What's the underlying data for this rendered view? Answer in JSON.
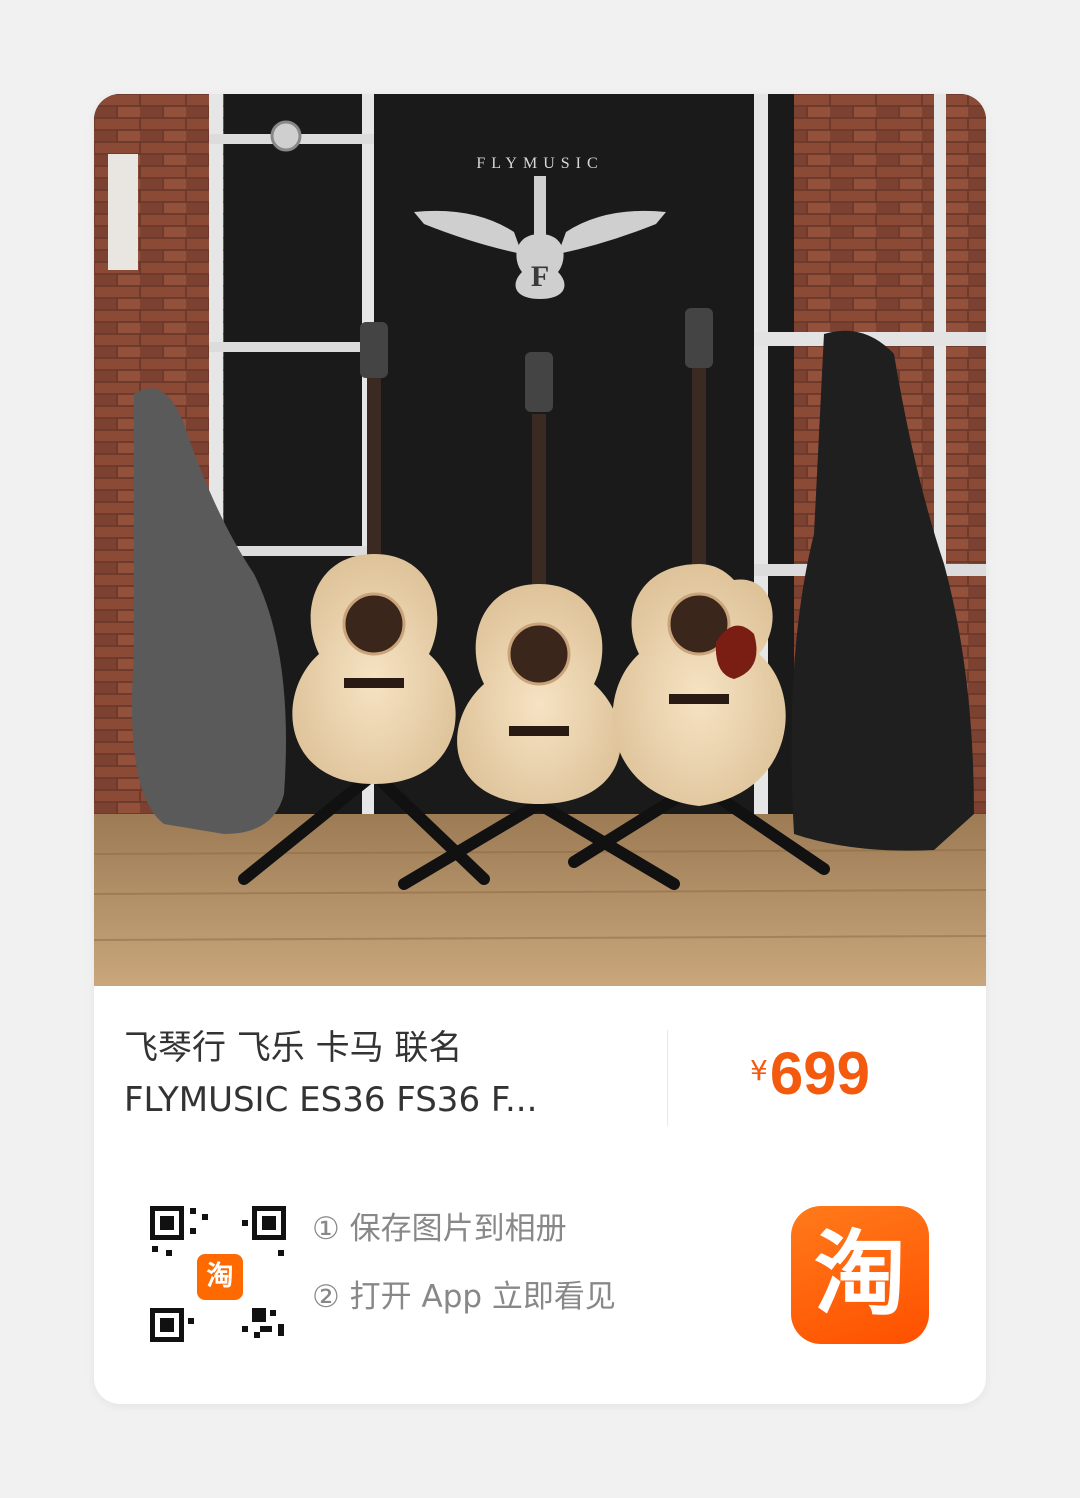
{
  "product": {
    "title_line1": "飞琴行 飞乐 卡马 联名",
    "title_line2": "FLYMUSIC ES36 FS36 F...",
    "price_currency": "¥",
    "price_value": "699"
  },
  "photo": {
    "logo_text": "FLYMUSIC",
    "logo_letter": "F",
    "description": "acoustic-guitars-on-stands-with-gig-bags"
  },
  "qr": {
    "badge_char": "淘"
  },
  "steps": {
    "step1": "① 保存图片到相册",
    "step2": "② 打开 App 立即看见"
  },
  "app_icon": {
    "char": "淘",
    "color": "#ff5000"
  },
  "colors": {
    "price": "#f35a0e",
    "card_bg": "#ffffff",
    "page_bg": "#f1f1f1"
  }
}
